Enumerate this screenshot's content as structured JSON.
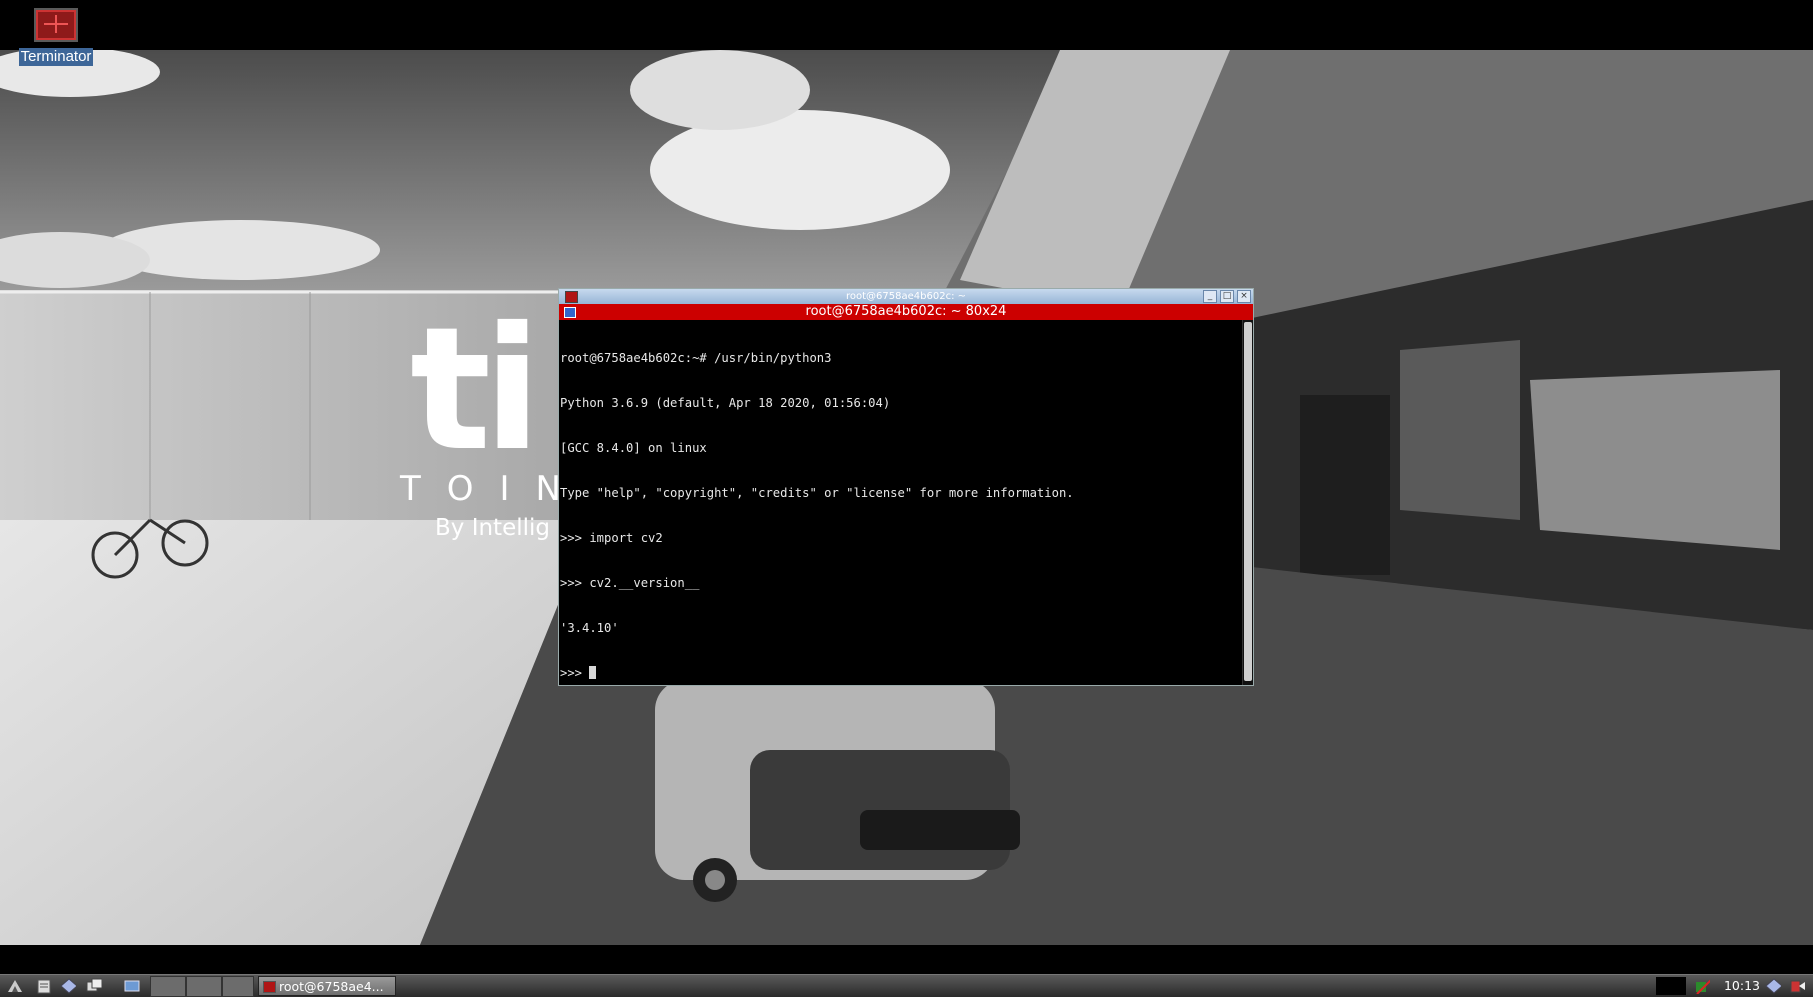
{
  "desktop": {
    "icon_label": "Terminator",
    "wallpaper": {
      "logo_mark": "ti",
      "logo_word": "TOIN",
      "logo_tagline": "By Intellig"
    }
  },
  "terminal": {
    "window_title": "root@6758ae4b602c: ~",
    "tab_title": "root@6758ae4b602c: ~ 80x24",
    "buttons": {
      "minimize": "_",
      "maximize": "□",
      "close": "×"
    },
    "lines": [
      "root@6758ae4b602c:~# /usr/bin/python3",
      "Python 3.6.9 (default, Apr 18 2020, 01:56:04)",
      "[GCC 8.4.0] on linux",
      "Type \"help\", \"copyright\", \"credits\" or \"license\" for more information.",
      ">>> import cv2",
      ">>> cv2.__version__",
      "'3.4.10'"
    ],
    "prompt": ">>> "
  },
  "taskbar": {
    "task_label": "root@6758ae4...",
    "clock": "10:13"
  },
  "colors": {
    "tab_bar": "#cc0000",
    "title_bar": "#a9c3e2",
    "icon_label_bg": "#3d6698"
  }
}
